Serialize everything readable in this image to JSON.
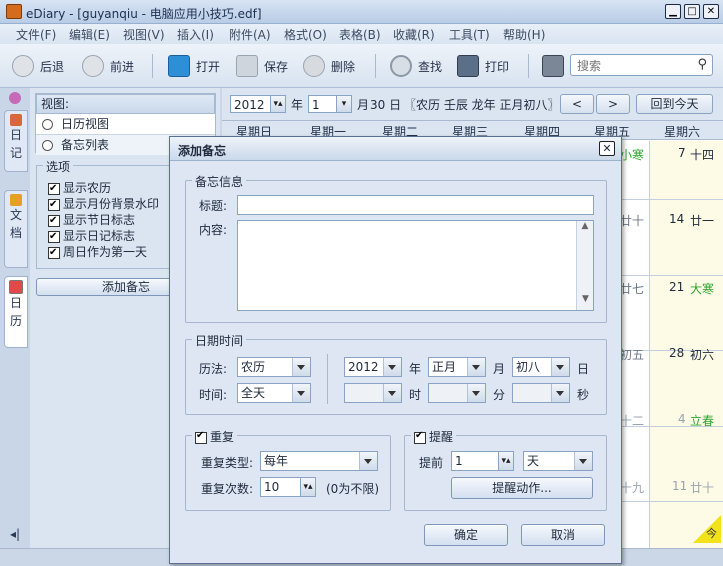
{
  "window": {
    "title": "eDiary - [guyanqiu - 电脑应用小技巧.edf]"
  },
  "menu": [
    "文件(F)",
    "编辑(E)",
    "视图(V)",
    "插入(I)",
    "附件(A)",
    "格式(O)",
    "表格(B)",
    "收藏(R)",
    "工具(T)",
    "帮助(H)"
  ],
  "toolbar": {
    "back": "后退",
    "forward": "前进",
    "open": "打开",
    "save": "保存",
    "delete": "删除",
    "find": "查找",
    "print": "打印",
    "search_placeholder": "搜索"
  },
  "vtabs": {
    "diary": "日记",
    "docs": "文档",
    "calendar": "日历"
  },
  "sidepanel": {
    "view_header": "视图:",
    "views": [
      "日历视图",
      "备忘列表"
    ],
    "options_title": "选项",
    "options": [
      "显示农历",
      "显示月份背景水印",
      "显示节日标志",
      "显示日记标志",
      "周日作为第一天"
    ],
    "add_memo": "添加备忘"
  },
  "calendar": {
    "year": "2012",
    "year_unit": "年",
    "month": "1",
    "month_unit": "月",
    "date_text": "30 日",
    "lunar_text": "〖农历 壬辰 龙年 正月初八〗",
    "today_button": "回到今天",
    "weekdays": [
      "星期日",
      "星期一",
      "星期二",
      "星期三",
      "星期四",
      "星期五",
      "星期六"
    ],
    "rows": [
      {
        "fri": "小寒",
        "sat_day": "7",
        "sat_lunar": "十四"
      },
      {
        "fri": "廿十",
        "sat_day": "14",
        "sat_lunar": "廿一"
      },
      {
        "fri": "廿七",
        "sat_day": "21",
        "sat_lunar": "大寒"
      },
      {
        "fri": "初五",
        "sat_day": "28",
        "sat_lunar": "初六"
      },
      {
        "fri": "十二",
        "sat_day": "4",
        "sat_lunar": "立春"
      },
      {
        "fri": "十九",
        "sat_day": "11",
        "sat_lunar": "廿十"
      }
    ],
    "corner_mark": "今"
  },
  "dialog": {
    "title": "添加备忘",
    "memo_info": "备忘信息",
    "title_label": "标题:",
    "title_value": "",
    "content_label": "内容:",
    "content_value": "",
    "datetime": "日期时间",
    "calendar_type_label": "历法:",
    "calendar_type": "农历",
    "year_value": "2012",
    "year_unit": "年",
    "month_value": "正月",
    "month_unit": "月",
    "day_value": "初八",
    "day_unit": "日",
    "time_label": "时间:",
    "time_value": "全天",
    "hour_unit": "时",
    "minute_unit": "分",
    "second_unit": "秒",
    "repeat": "重复",
    "repeat_type_label": "重复类型:",
    "repeat_type": "每年",
    "repeat_count_label": "重复次数:",
    "repeat_count": "10",
    "repeat_hint": "(0为不限)",
    "remind": "提醒",
    "advance_label": "提前",
    "advance_value": "1",
    "advance_unit": "天",
    "remind_action": "提醒动作...",
    "ok": "确定",
    "cancel": "取消"
  }
}
